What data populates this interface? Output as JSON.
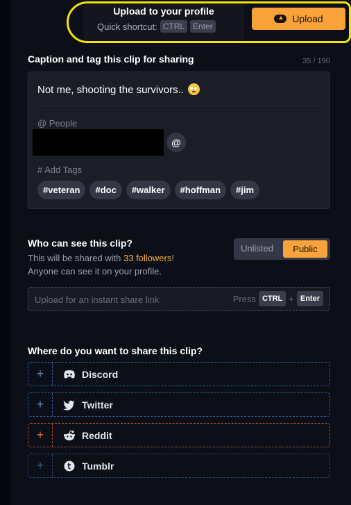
{
  "upload": {
    "title": "Upload to your profile",
    "shortcut_label": "Quick shortcut:",
    "key1": "CTRL",
    "key2": "Enter",
    "button_label": "Upload"
  },
  "caption": {
    "section_title": "Caption and tag this clip for sharing",
    "counter": "35 / 190",
    "text": "Not me, shooting the survivors..",
    "emoji_icon": "face-with-rolling-eyes-icon",
    "people_label": "@ People",
    "at_button": "@",
    "tags_label": "# Add Tags",
    "tags": [
      "#veteran",
      "#doc",
      "#walker",
      "#hoffman",
      "#jim"
    ]
  },
  "visibility": {
    "title": "Who can see this clip?",
    "shared_prefix": "This will be shared with ",
    "followers": "33 followers",
    "shared_suffix": "!",
    "anyone_text": "Anyone can see it on your profile.",
    "options": [
      "Unlisted",
      "Public"
    ],
    "selected": "Public",
    "link_placeholder": "Upload for an instant share link",
    "press_label": "Press",
    "key1": "CTRL",
    "plus": "+",
    "key2": "Enter"
  },
  "share": {
    "title": "Where do you want to share this clip?",
    "targets": [
      {
        "label": "Discord",
        "icon": "discord-icon",
        "plus": "+"
      },
      {
        "label": "Twitter",
        "icon": "twitter-icon",
        "plus": "+"
      },
      {
        "label": "Reddit",
        "icon": "reddit-icon",
        "plus": "+"
      },
      {
        "label": "Tumblr",
        "icon": "tumblr-icon",
        "plus": "+"
      }
    ]
  },
  "colors": {
    "accent": "#f9a23a",
    "highlight_border": "#f5e400",
    "background": "#0d0f18"
  }
}
